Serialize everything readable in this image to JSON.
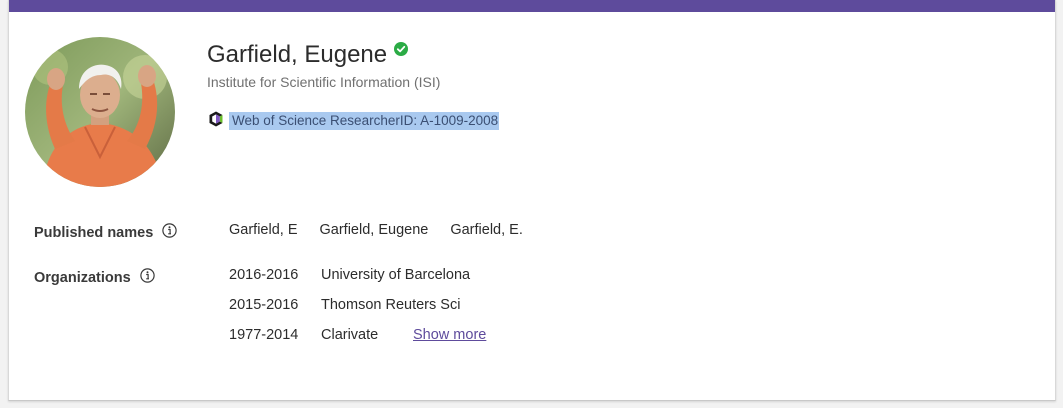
{
  "profile": {
    "name": "Garfield, Eugene",
    "institution": "Institute for Scientific Information (ISI)",
    "researcher_id": "Web of Science ResearcherID: A-1009-2008",
    "verified_color": "#2bab45"
  },
  "published_names": {
    "label": "Published names",
    "names": [
      "Garfield, E",
      "Garfield, Eugene",
      "Garfield, E."
    ]
  },
  "organizations": {
    "label": "Organizations",
    "items": [
      {
        "years": "2016-2016",
        "name": "University of Barcelona"
      },
      {
        "years": "2015-2016",
        "name": "Thomson Reuters Sci"
      },
      {
        "years": "1977-2014",
        "name": "Clarivate"
      }
    ],
    "show_more": "Show more"
  },
  "theme": {
    "accent": "#5e4b9c",
    "selection_highlight": "#a9c9ef"
  }
}
